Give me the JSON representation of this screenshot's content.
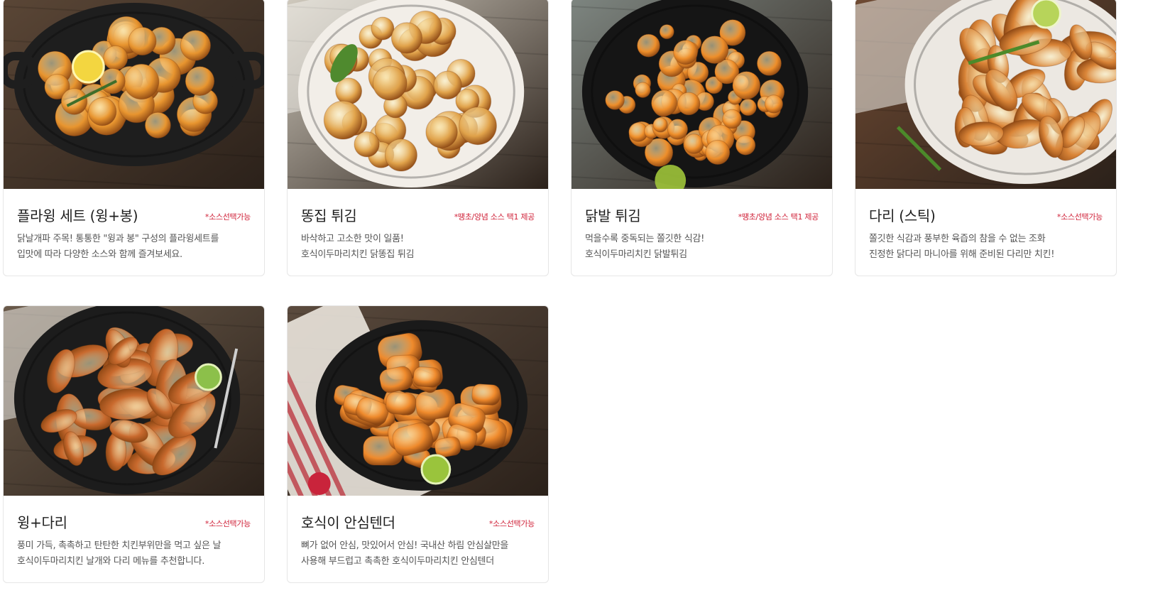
{
  "products": [
    {
      "name": "플라윙 세트 (윙+봉)",
      "badge": "*소스선택가능",
      "desc_line1": "닭날개파 주목! 통통한 \"윙과 봉\" 구성의 플라윙세트를",
      "desc_line2": "입맛에 따라 다양한 소스와 함께 즐겨보세요.",
      "image_icon": "fried-chicken-wings-pan-image",
      "colors": {
        "bg": "#5a4636",
        "plate": "#1e1e1e",
        "food": "#e8952f",
        "accent": "#f3d640"
      }
    },
    {
      "name": "똥집 튀김",
      "badge": "*땡초/양념 소스 택1 제공",
      "desc_line1": "바삭하고 고소한 맛이 일품!",
      "desc_line2": "호식이두마리치킨 닭똥집 튀김",
      "image_icon": "fried-gizzard-plate-image",
      "colors": {
        "bg": "#cfc9bd",
        "plate": "#f2eee8",
        "food": "#e0a24a",
        "accent": "#4f8a2e"
      }
    },
    {
      "name": "닭발 튀김",
      "badge": "*땡초/양념 소스 택1 제공",
      "desc_line1": "먹을수록 중독되는 쫄깃한 식감!",
      "desc_line2": "호식이두마리치킨 닭발튀김",
      "image_icon": "fried-chicken-feet-plate-image",
      "colors": {
        "bg": "#7d8580",
        "plate": "#151515",
        "food": "#ee8e2a",
        "accent": "#9fc43a"
      }
    },
    {
      "name": "다리 (스틱)",
      "badge": "*소스선택가능",
      "desc_line1": "쫄깃한 식감과 풍부한 육즙의 참을 수 없는 조화",
      "desc_line2": "진정한 닭다리 마니아를 위해 준비된 다리만 치킨!",
      "image_icon": "fried-drumsticks-board-image",
      "colors": {
        "bg": "#6e4a33",
        "plate": "#ece8e2",
        "food": "#d98437",
        "accent": "#4c8a2a"
      }
    },
    {
      "name": "윙+다리",
      "badge": "*소스선택가능",
      "desc_line1": "풍미 가득, 촉촉하고 탄탄한 치킨부위만을 먹고 싶은 날",
      "desc_line2": "호식이두마리치킨 날개와 다리 메뉴를 추천합니다.",
      "image_icon": "wings-and-legs-plate-image",
      "colors": {
        "bg": "#6a5a4a",
        "plate": "#1c1c1c",
        "food": "#c96a2e",
        "accent": "#8cc04a"
      }
    },
    {
      "name": "호식이 안심텐더",
      "badge": "*소스선택가능",
      "desc_line1": "뼈가 없어 안심, 맛있어서 안심! 국내산 하림 안심살만을",
      "desc_line2": "사용해 부드럽고 촉촉한 호식이두마리치킨 안심텐더",
      "image_icon": "fried-tenders-skillet-image",
      "colors": {
        "bg": "#5b4b3e",
        "plate": "#1a1a1a",
        "food": "#ef8a2c",
        "accent": "#9ac43c"
      }
    }
  ]
}
